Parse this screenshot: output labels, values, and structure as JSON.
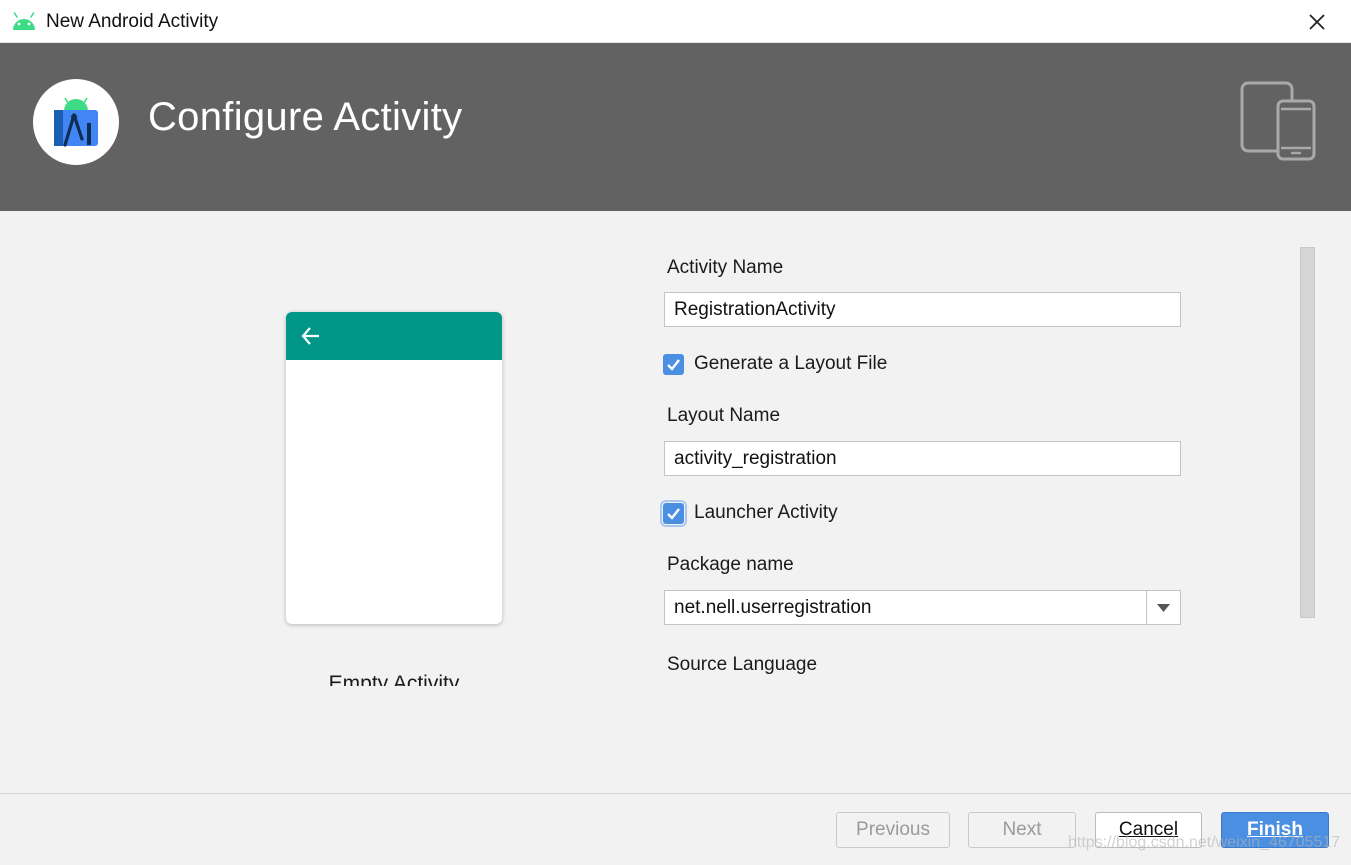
{
  "window": {
    "title": "New Android Activity",
    "icon": "android-icon",
    "close_icon": "close-icon"
  },
  "banner": {
    "heading": "Configure Activity",
    "logo_icon": "android-studio-logo-icon",
    "devices_icon": "phone-tablet-icon",
    "background": "#626262"
  },
  "preview": {
    "label": "Empty Activity",
    "appbar_color": "#009688",
    "back_icon": "back-arrow-icon"
  },
  "form": {
    "activity_name_label": "Activity Name",
    "activity_name_value": "RegistrationActivity",
    "generate_layout_label": "Generate a Layout File",
    "generate_layout_checked": true,
    "layout_name_label": "Layout Name",
    "layout_name_value": "activity_registration",
    "launcher_activity_label": "Launcher Activity",
    "launcher_activity_checked": true,
    "package_name_label": "Package name",
    "package_name_value": "net.nell.userregistration",
    "source_language_label": "Source Language"
  },
  "footer": {
    "previous_label": "Previous",
    "next_label": "Next",
    "cancel_label": "Cancel",
    "finish_label": "Finish"
  },
  "watermark": "https://blog.csdn.net/weixin_46705517",
  "colors": {
    "accent": "#4a8fe1",
    "teal": "#009688"
  }
}
